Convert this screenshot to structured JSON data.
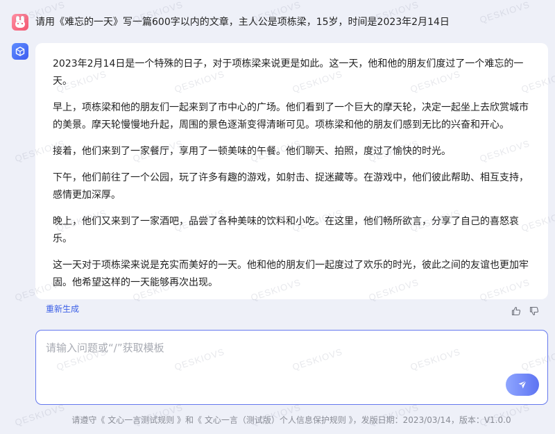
{
  "prompt": {
    "text": "请用《难忘的一天》写一篇600字以内的文章，主人公是项栋梁，15岁，时间是2023年2月14日"
  },
  "answer": {
    "paragraphs": [
      "2023年2月14日是一个特殊的日子，对于项栋梁来说更是如此。这一天，他和他的朋友们度过了一个难忘的一天。",
      "早上，项栋梁和他的朋友们一起来到了市中心的广场。他们看到了一个巨大的摩天轮，决定一起坐上去欣赏城市的美景。摩天轮慢慢地升起，周围的景色逐渐变得清晰可见。项栋梁和他的朋友们感到无比的兴奋和开心。",
      "接着，他们来到了一家餐厅，享用了一顿美味的午餐。他们聊天、拍照，度过了愉快的时光。",
      "下午，他们前往了一个公园，玩了许多有趣的游戏，如射击、捉迷藏等。在游戏中，他们彼此帮助、相互支持，感情更加深厚。",
      "晚上，他们又来到了一家酒吧，品尝了各种美味的饮料和小吃。在这里，他们畅所欲言，分享了自己的喜怒哀乐。",
      "这一天对于项栋梁来说是充实而美好的一天。他和他的朋友们一起度过了欢乐的时光，彼此之间的友谊也更加牢固。他希望这样的一天能够再次出现。"
    ]
  },
  "actions": {
    "regenerate_label": "重新生成",
    "like_icon": "thumbs-up-icon",
    "dislike_icon": "thumbs-down-icon"
  },
  "input": {
    "value": "",
    "placeholder": "请输入问题或“/”获取模板",
    "send_icon": "send-icon"
  },
  "footer": {
    "text": "请遵守《 文心一言测试规则 》和《 文心一言（测试版）个人信息保护规则 》，发版日期：2023/03/14，版本：V1.0.0"
  },
  "watermark": {
    "text": "QESKIOVS"
  },
  "colors": {
    "accent": "#3a5ee6",
    "page_background": "#eef0f8",
    "input_border": "#6478ee"
  }
}
